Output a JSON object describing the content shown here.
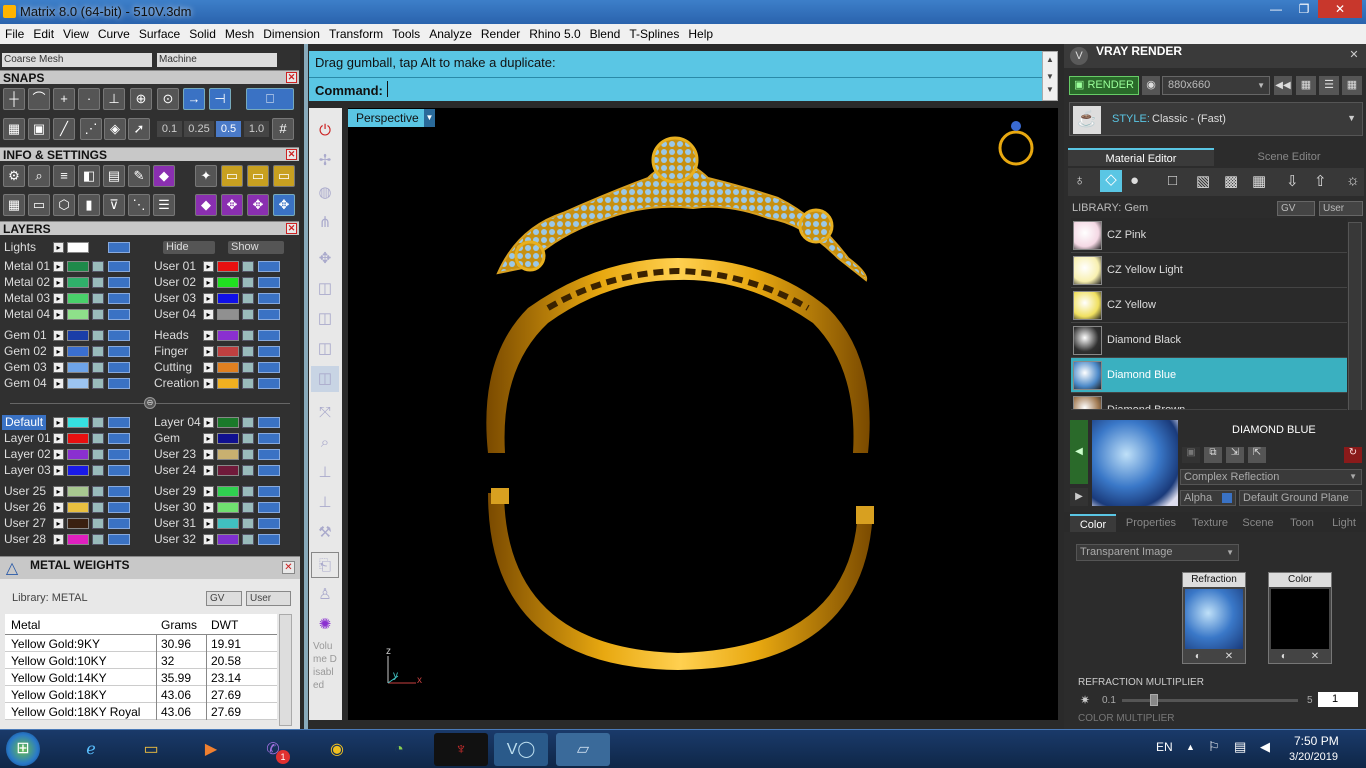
{
  "window": {
    "title": "Matrix 8.0 (64-bit) - 510V.3dm",
    "min": "—",
    "max": "❐",
    "close": "✕"
  },
  "menu": [
    "File",
    "Edit",
    "View",
    "Curve",
    "Surface",
    "Solid",
    "Mesh",
    "Dimension",
    "Transform",
    "Tools",
    "Analyze",
    "Render",
    "Rhino 5.0",
    "Blend",
    "T-Splines",
    "Help"
  ],
  "mesh": {
    "left": "Coarse Mesh",
    "right": "Machine"
  },
  "snaps": {
    "title": "SNAPS",
    "values": [
      "0.1",
      "0.25",
      "0.5",
      "1.0"
    ]
  },
  "info": {
    "title": "INFO & SETTINGS"
  },
  "layers": {
    "title": "LAYERS",
    "lights": "Lights",
    "hide": "Hide",
    "show": "Show",
    "left": [
      {
        "name": "Metal 01",
        "color": "#1e8a4a"
      },
      {
        "name": "Metal 02",
        "color": "#2fb06a"
      },
      {
        "name": "Metal 03",
        "color": "#49d06a"
      },
      {
        "name": "Metal 04",
        "color": "#8ee08a"
      },
      {
        "name": "Gem 01",
        "color": "#1a3ea8"
      },
      {
        "name": "Gem 02",
        "color": "#3a6fd0"
      },
      {
        "name": "Gem 03",
        "color": "#6ea4e8"
      },
      {
        "name": "Gem 04",
        "color": "#9cc4f0"
      },
      {
        "name": "Default",
        "color": "#35e0e0"
      },
      {
        "name": "Layer 01",
        "color": "#e81010"
      },
      {
        "name": "Layer 02",
        "color": "#8a2fd0"
      },
      {
        "name": "Layer 03",
        "color": "#1a1ae8"
      },
      {
        "name": "User 25",
        "color": "#a8c890"
      },
      {
        "name": "User 26",
        "color": "#e8c040"
      },
      {
        "name": "User 27",
        "color": "#3a2010"
      },
      {
        "name": "User 28",
        "color": "#e020c0"
      }
    ],
    "right": [
      {
        "name": "User 01",
        "color": "#e81010"
      },
      {
        "name": "User 02",
        "color": "#20e020"
      },
      {
        "name": "User 03",
        "color": "#1010e8"
      },
      {
        "name": "User 04",
        "color": "#909090"
      },
      {
        "name": "Heads",
        "color": "#8a2fd0"
      },
      {
        "name": "Finger",
        "color": "#c04040"
      },
      {
        "name": "Cutting",
        "color": "#e08020"
      },
      {
        "name": "Creation",
        "color": "#f0b020"
      },
      {
        "name": "Layer 04",
        "color": "#1a7a2a"
      },
      {
        "name": "Gem",
        "color": "#101090"
      },
      {
        "name": "User 23",
        "color": "#c8b070"
      },
      {
        "name": "User 24",
        "color": "#701a3a"
      },
      {
        "name": "User 29",
        "color": "#30d050"
      },
      {
        "name": "User 30",
        "color": "#70e070"
      },
      {
        "name": "User 31",
        "color": "#40c0c0"
      },
      {
        "name": "User 32",
        "color": "#8030d0"
      }
    ]
  },
  "metal_weights": {
    "title": "METAL WEIGHTS",
    "library": "Library: METAL",
    "gv": "GV",
    "user": "User",
    "headers": [
      "Metal",
      "Grams",
      "DWT"
    ],
    "rows": [
      [
        "Yellow Gold:9KY",
        "30.96",
        "19.91"
      ],
      [
        "Yellow Gold:10KY",
        "32",
        "20.58"
      ],
      [
        "Yellow Gold:14KY",
        "35.99",
        "23.14"
      ],
      [
        "Yellow Gold:18KY",
        "43.06",
        "27.69"
      ],
      [
        "Yellow Gold:18KY Royal",
        "43.06",
        "27.69"
      ]
    ]
  },
  "command": {
    "message": "Drag gumball, tap Alt to make a duplicate:",
    "label": "Command:",
    "value": ""
  },
  "viewport": {
    "name": "Perspective",
    "axis_z": "z",
    "axis_y": "y",
    "axis_x": "x"
  },
  "side_text": "Volume Disabled",
  "vray": {
    "title": "VRAY RENDER",
    "render": "RENDER",
    "resolution": "880x660",
    "style_label": "STYLE:",
    "style_value": "Classic - (Fast)",
    "tabs": [
      "Material Editor",
      "Scene Editor"
    ],
    "library": "LIBRARY: Gem",
    "gv": "GV",
    "user": "User",
    "gems": [
      {
        "name": "CZ Pink",
        "color": "#f4d8e4"
      },
      {
        "name": "CZ Yellow Light",
        "color": "#f8f0b0"
      },
      {
        "name": "CZ Yellow",
        "color": "#f0e060"
      },
      {
        "name": "Diamond Black",
        "color": "#303030"
      },
      {
        "name": "Diamond Blue",
        "color": "#4a88c8"
      },
      {
        "name": "Diamond Brown",
        "color": "#a07850"
      }
    ],
    "selected_name": "DIAMOND BLUE",
    "reflection": "Complex Reflection",
    "alpha": "Alpha",
    "ground": "Default Ground Plane",
    "subtabs": [
      "Color",
      "Properties",
      "Texture",
      "Scene",
      "Toon",
      "Light"
    ],
    "color_mode": "Transparent Image",
    "refraction": "Refraction",
    "color": "Color",
    "refraction_multiplier": "REFRACTION MULTIPLIER",
    "rm_min": "0.1",
    "rm_max": "5",
    "rm_value": "1",
    "color_multiplier": "COLOR MULTIPLIER"
  },
  "taskbar": {
    "lang": "EN",
    "time": "7:50 PM",
    "date": "3/20/2019",
    "badge": "1"
  }
}
